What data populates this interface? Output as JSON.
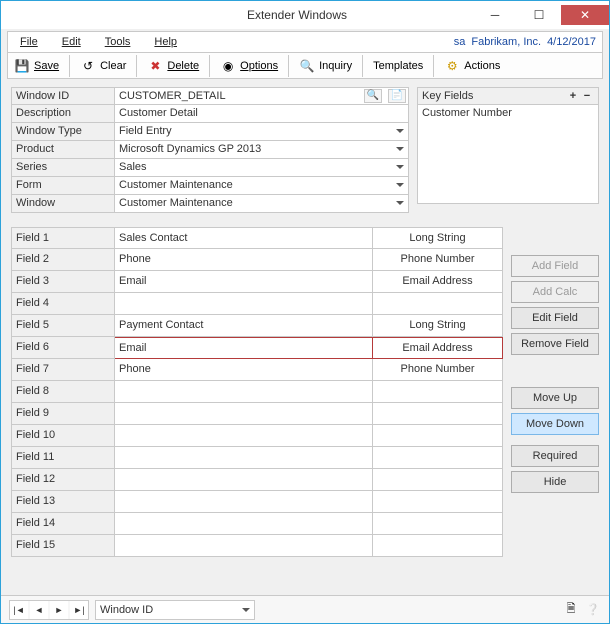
{
  "title": "Extender Windows",
  "menubar": {
    "items": [
      "File",
      "Edit",
      "Tools",
      "Help"
    ],
    "user": "sa",
    "company": "Fabrikam, Inc.",
    "date": "4/12/2017"
  },
  "toolbar": {
    "save": "Save",
    "clear": "Clear",
    "delete": "Delete",
    "options": "Options",
    "inquiry": "Inquiry",
    "templates": "Templates",
    "actions": "Actions"
  },
  "form": {
    "window_id": {
      "label": "Window ID",
      "value": "CUSTOMER_DETAIL"
    },
    "description": {
      "label": "Description",
      "value": "Customer Detail"
    },
    "window_type": {
      "label": "Window Type",
      "value": "Field Entry"
    },
    "product": {
      "label": "Product",
      "value": "Microsoft Dynamics GP 2013"
    },
    "series": {
      "label": "Series",
      "value": "Sales"
    },
    "form_name": {
      "label": "Form",
      "value": "Customer Maintenance"
    },
    "window": {
      "label": "Window",
      "value": "Customer Maintenance"
    }
  },
  "keyfields": {
    "title": "Key Fields",
    "items": [
      "Customer Number"
    ]
  },
  "fields": {
    "labels": [
      "Field 1",
      "Field 2",
      "Field 3",
      "Field 4",
      "Field 5",
      "Field 6",
      "Field 7",
      "Field 8",
      "Field 9",
      "Field 10",
      "Field 11",
      "Field 12",
      "Field 13",
      "Field 14",
      "Field 15"
    ],
    "rows": [
      {
        "name": "Sales Contact",
        "type": "Long String"
      },
      {
        "name": "Phone",
        "type": "Phone Number"
      },
      {
        "name": "Email",
        "type": "Email Address"
      },
      {
        "name": "",
        "type": ""
      },
      {
        "name": "Payment Contact",
        "type": "Long String"
      },
      {
        "name": "Email",
        "type": "Email Address",
        "selected": true
      },
      {
        "name": "Phone",
        "type": "Phone Number"
      },
      {
        "name": "",
        "type": ""
      },
      {
        "name": "",
        "type": ""
      },
      {
        "name": "",
        "type": ""
      },
      {
        "name": "",
        "type": ""
      },
      {
        "name": "",
        "type": ""
      },
      {
        "name": "",
        "type": ""
      },
      {
        "name": "",
        "type": ""
      },
      {
        "name": "",
        "type": ""
      }
    ]
  },
  "actions": {
    "add_field": "Add Field",
    "add_calc": "Add Calc",
    "edit_field": "Edit Field",
    "remove_field": "Remove Field",
    "move_up": "Move Up",
    "move_down": "Move Down",
    "required": "Required",
    "hide": "Hide"
  },
  "statusbar": {
    "page": "Window ID"
  }
}
